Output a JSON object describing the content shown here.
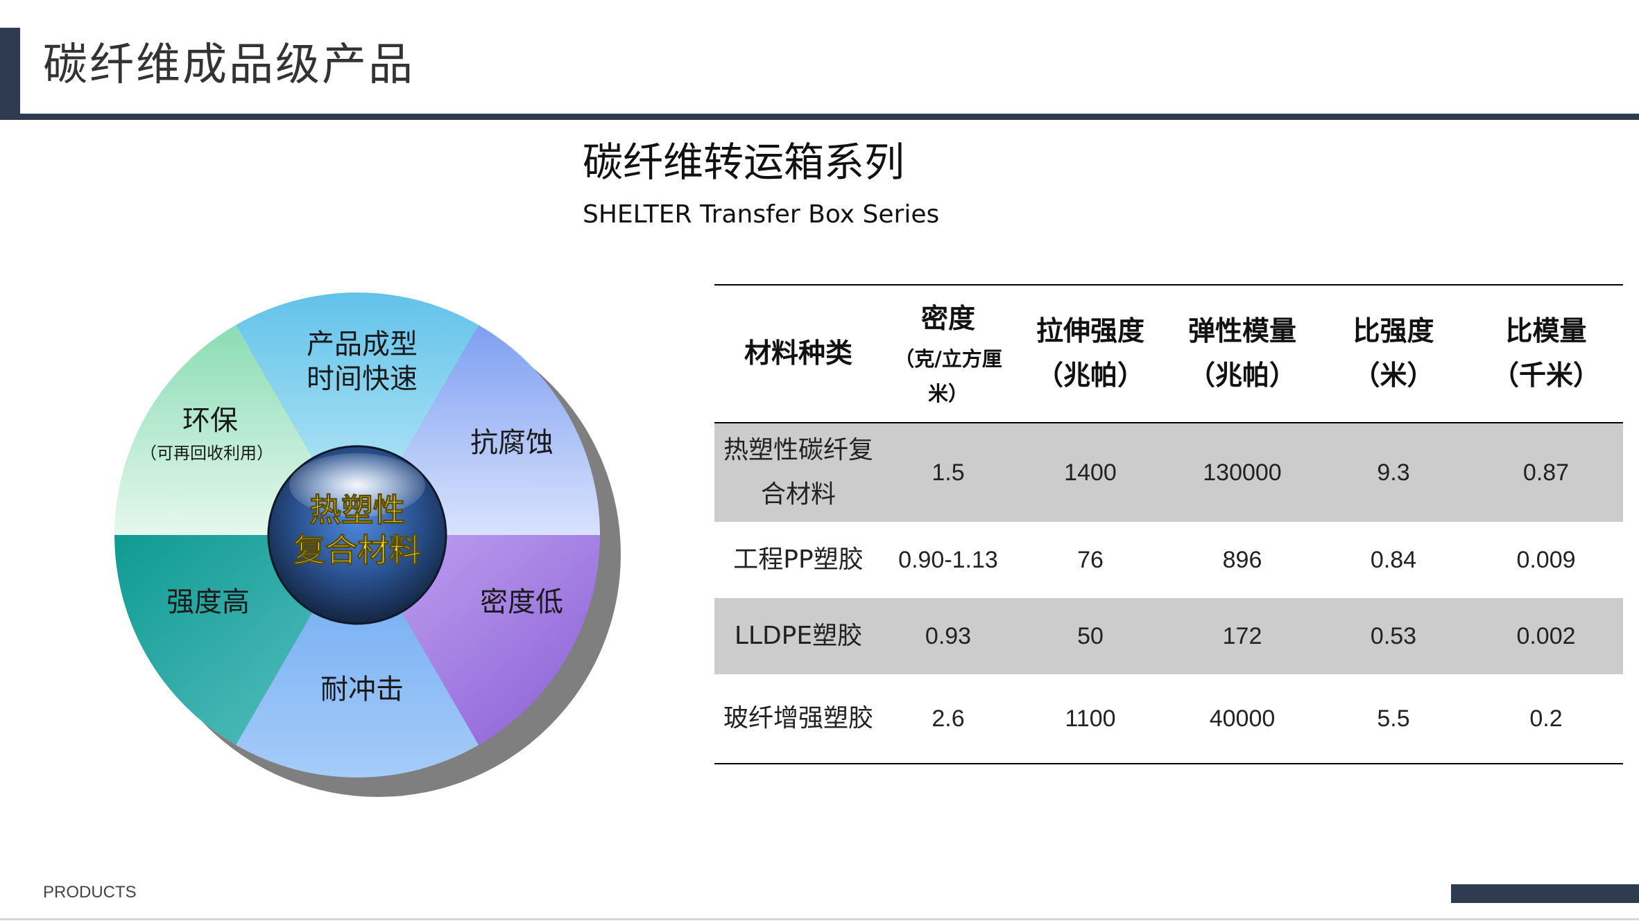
{
  "page": {
    "title": "碳纤维成品级产品",
    "footer_label": "PRODUCTS"
  },
  "section": {
    "title": "碳纤维转运箱系列",
    "subtitle": "SHELTER Transfer Box Series"
  },
  "wheel": {
    "center_line1": "热塑性",
    "center_line2": "复合材料",
    "segments": [
      {
        "line1": "产品成型",
        "line2": "时间快速"
      },
      {
        "line1": "抗腐蚀"
      },
      {
        "line1": "密度低"
      },
      {
        "line1": "耐冲击"
      },
      {
        "line1": "强度高"
      },
      {
        "line1": "环保",
        "line2": "（可再回收利用）"
      }
    ],
    "colors": {
      "top": "#6cc6e8",
      "upper_right": "#8aa6f4",
      "lower_right": "#a57de2",
      "bottom": "#8ab8f4",
      "lower_left": "#26a69a",
      "upper_left": "#a6e6c6",
      "shadow": "#7f7f7f",
      "center": "#2a5290",
      "center_text": "#f5e93a"
    }
  },
  "table": {
    "headers": [
      {
        "line1": "材料种类"
      },
      {
        "line1": "密度",
        "line2": "（克/立方厘",
        "line3": "米）"
      },
      {
        "line1": "拉伸强度",
        "line2": "（兆帕）"
      },
      {
        "line1": "弹性模量",
        "line2": "（兆帕）"
      },
      {
        "line1": "比强度",
        "line2": "（米）"
      },
      {
        "line1": "比模量",
        "line2": "（千米）"
      }
    ],
    "rows": [
      {
        "name_line1": "热塑性碳纤复",
        "name_line2": "合材料",
        "density": "1.5",
        "tensile": "1400",
        "modulus": "130000",
        "specific_strength": "9.3",
        "specific_modulus": "0.87"
      },
      {
        "name_line1": "工程PP塑胶",
        "density": "0.90-1.13",
        "tensile": "76",
        "modulus": "896",
        "specific_strength": "0.84",
        "specific_modulus": "0.009"
      },
      {
        "name_line1": "LLDPE塑胶",
        "density": "0.93",
        "tensile": "50",
        "modulus": "172",
        "specific_strength": "0.53",
        "specific_modulus": "0.002"
      },
      {
        "name_line1": "玻纤增强塑胶",
        "density": "2.6",
        "tensile": "1100",
        "modulus": "40000",
        "specific_strength": "5.5",
        "specific_modulus": "0.2"
      }
    ]
  }
}
